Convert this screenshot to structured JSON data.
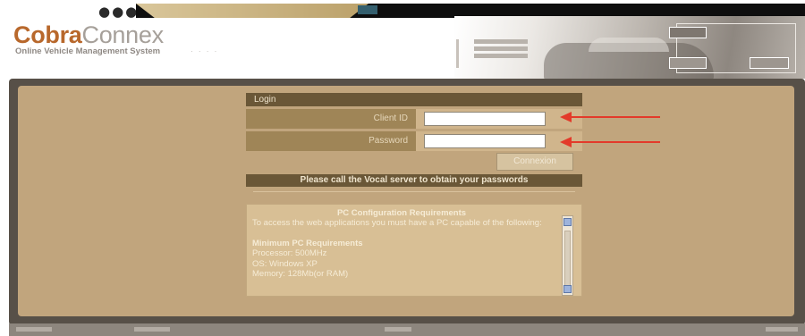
{
  "app": {
    "brand_part1": "Cobra",
    "brand_part2": "Connex",
    "tagline": "Online Vehicle Management System",
    "window_dots": "●●●"
  },
  "login": {
    "header": "Login",
    "client_id_label": "Client ID",
    "client_id_value": "",
    "password_label": "Password",
    "password_value": "",
    "connect_label": "Connexion"
  },
  "notice": {
    "call_text": "Please call the Vocal server to obtain your passwords"
  },
  "requirements": {
    "title": "PC Configuration Requirements",
    "intro": "To access the web applications you must have a PC capable of the following:",
    "min_heading": "Minimum PC Requirements",
    "processor": "Processor: 500MHz",
    "os": "OS: Windows XP",
    "memory": "Memory: 128Mb(or RAM)"
  },
  "colors": {
    "brand_orange": "#b8682c",
    "panel_tan": "#c1a57d",
    "header_brown": "#6a5737",
    "arrow_red": "#e33a2a"
  }
}
